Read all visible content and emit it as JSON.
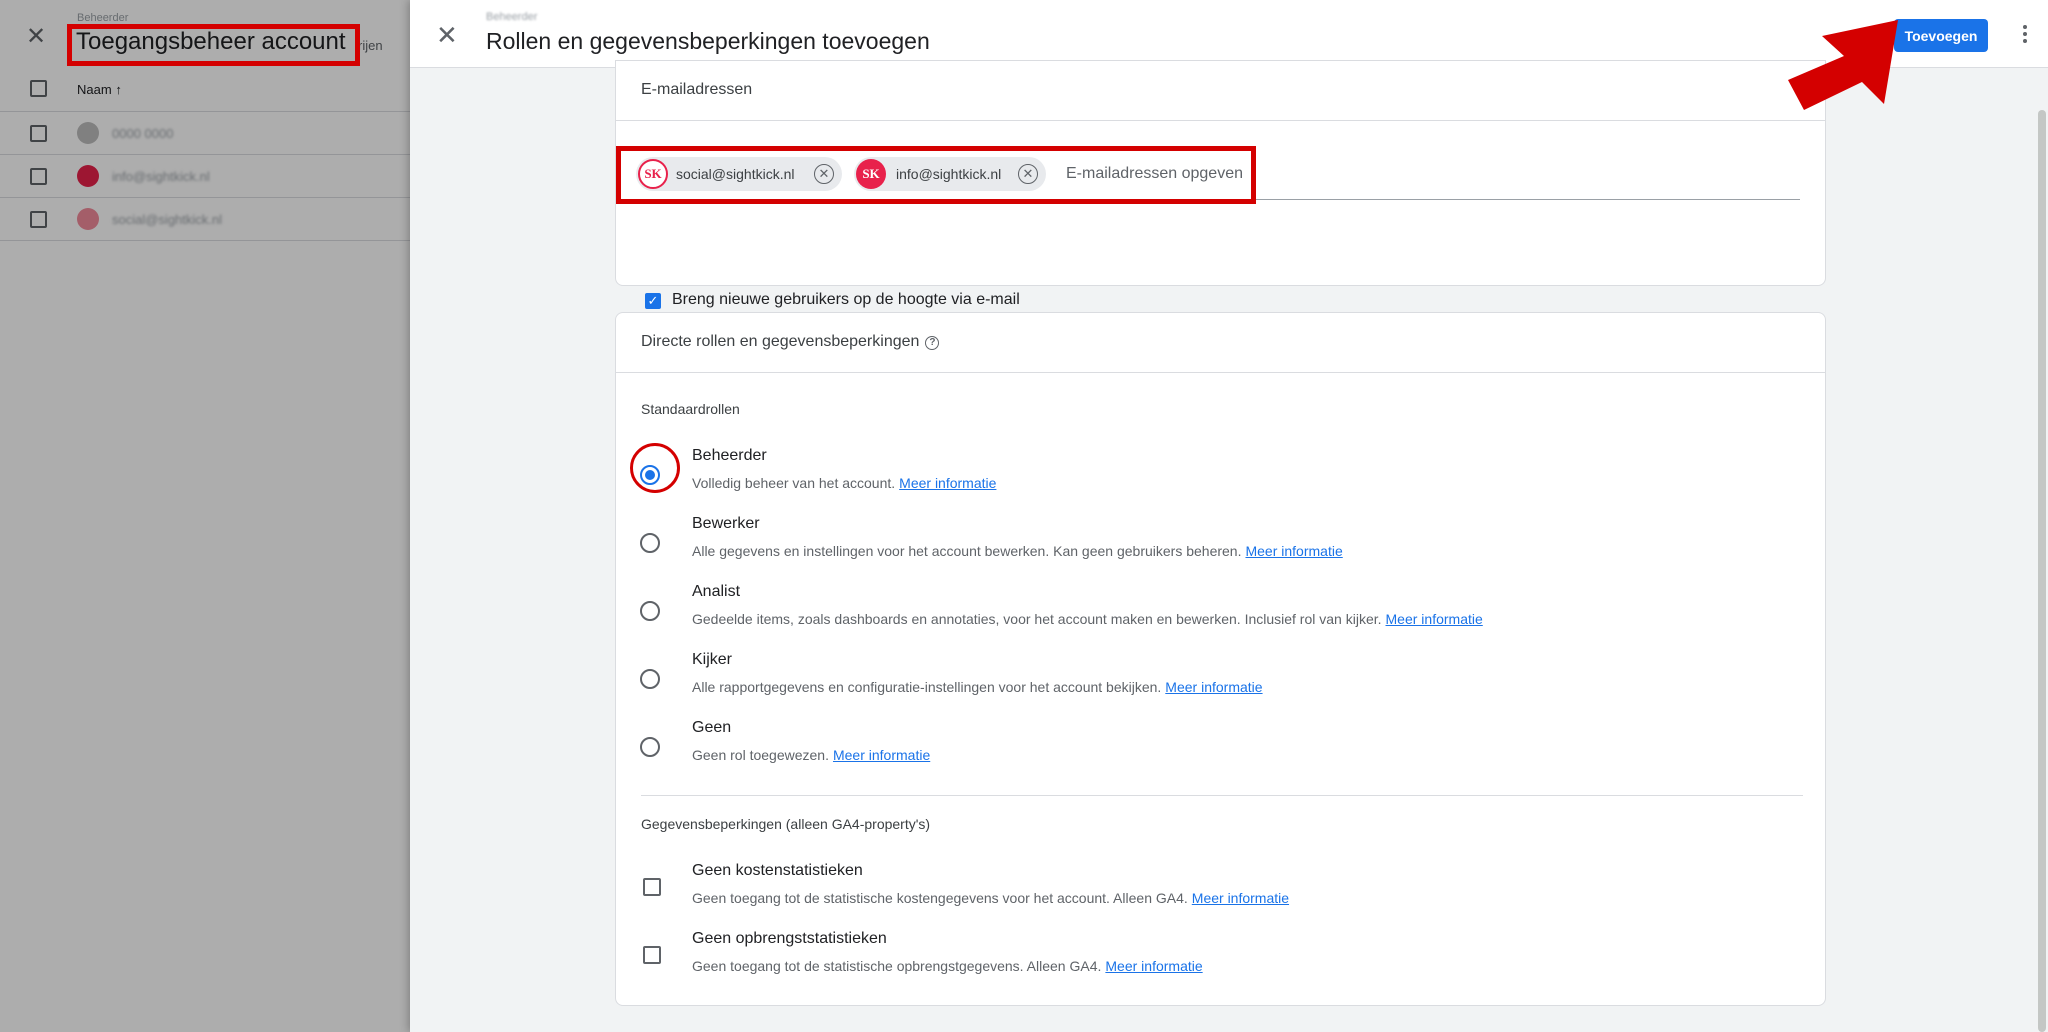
{
  "background": {
    "breadcrumb": "Beheerder",
    "title": "Toegangsbeheer account",
    "rows_label": "rijen",
    "column_name": "Naam",
    "sort_arrow": "↑",
    "rows": [
      {
        "text": "0000 0000",
        "avatar_color": "#bdbdbd"
      },
      {
        "text": "info@sightkick.nl",
        "avatar_color": "#e8214b"
      },
      {
        "text": "social@sightkick.nl",
        "avatar_color": "#f28b9b"
      }
    ]
  },
  "panel": {
    "breadcrumb": "Beheerder",
    "title": "Rollen en gegevensbeperkingen toevoegen",
    "close_icon": "close-icon",
    "add_button": "Toevoegen",
    "more_icon": "more-vert-icon"
  },
  "email_section": {
    "header": "E-mailadressen",
    "chips": [
      {
        "email": "social@sightkick.nl",
        "avatar": "SK",
        "avatar_color": "#e8214b",
        "avatar_style": "outline"
      },
      {
        "email": "info@sightkick.nl",
        "avatar": "SK",
        "avatar_color": "#e8214b",
        "avatar_style": "filled"
      }
    ],
    "input_placeholder": "E-mailadressen opgeven",
    "notify_label": "Breng nieuwe gebruikers op de hoogte via e-mail",
    "notify_checked": true
  },
  "roles_section": {
    "header": "Directe rollen en gegevensbeperkingen",
    "standard_roles_label": "Standaardrollen",
    "roles": [
      {
        "name": "Beheerder",
        "desc": "Volledig beheer van het account.",
        "link": "Meer informatie",
        "selected": true
      },
      {
        "name": "Bewerker",
        "desc": "Alle gegevens en instellingen voor het account bewerken. Kan geen gebruikers beheren.",
        "link": "Meer informatie",
        "selected": false
      },
      {
        "name": "Analist",
        "desc": "Gedeelde items, zoals dashboards en annotaties, voor het account maken en bewerken. Inclusief rol van kijker.",
        "link": "Meer informatie",
        "selected": false
      },
      {
        "name": "Kijker",
        "desc": "Alle rapportgegevens en configuratie-instellingen voor het account bekijken.",
        "link": "Meer informatie",
        "selected": false
      },
      {
        "name": "Geen",
        "desc": "Geen rol toegewezen.",
        "link": "Meer informatie",
        "selected": false
      }
    ],
    "data_restrictions_label": "Gegevensbeperkingen (alleen GA4-property's)",
    "restrictions": [
      {
        "name": "Geen kostenstatistieken",
        "desc": "Geen toegang tot de statistische kostengegevens voor het account. Alleen GA4.",
        "link": "Meer informatie",
        "checked": false
      },
      {
        "name": "Geen opbrengststatistieken",
        "desc": "Geen toegang tot de statistische opbrengstgegevens. Alleen GA4.",
        "link": "Meer informatie",
        "checked": false
      }
    ]
  },
  "colors": {
    "accent": "#1a73e8",
    "highlight": "#d40000",
    "brand": "#e8214b"
  }
}
